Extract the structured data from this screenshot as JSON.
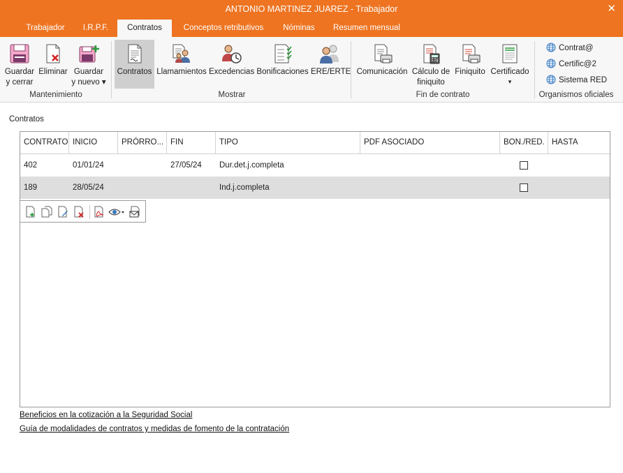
{
  "window": {
    "title": "ANTONIO MARTINEZ JUAREZ - Trabajador",
    "close_label": "✕"
  },
  "tabs": [
    {
      "label": "Trabajador"
    },
    {
      "label": "I.R.P.F."
    },
    {
      "label": "Contratos"
    },
    {
      "label": "Conceptos retributivos"
    },
    {
      "label": "Nóminas"
    },
    {
      "label": "Resumen mensual"
    }
  ],
  "ribbon": {
    "mantenimiento": {
      "label": "Mantenimiento",
      "guardar_cerrar": [
        "Guardar",
        "y cerrar"
      ],
      "eliminar": "Eliminar",
      "guardar_nuevo": [
        "Guardar",
        "y nuevo ▾"
      ]
    },
    "mostrar": {
      "label": "Mostrar",
      "contratos": "Contratos",
      "llamamientos": "Llamamientos",
      "excedencias": "Excedencias",
      "bonificaciones": "Bonificaciones",
      "ere": "ERE/ERTE"
    },
    "fin": {
      "label": "Fin de contrato",
      "comunicacion": "Comunicación",
      "calculo": [
        "Cálculo de",
        "finiquito"
      ],
      "finiquito": "Finiquito",
      "certificado": "Certificado",
      "certificado_arrow": "▾"
    },
    "organismos": {
      "label": "Organismos oficiales",
      "items": [
        "Contrat@",
        "Certific@2",
        "Sistema RED"
      ]
    }
  },
  "contratos": {
    "title": "Contratos",
    "columns": [
      "CONTRATO",
      "INICIO",
      "PRÓRRO...",
      "FIN",
      "TIPO",
      "PDF ASOCIADO",
      "BON./RED.",
      "HASTA"
    ],
    "rows": [
      {
        "contrato": "402",
        "inicio": "01/01/24",
        "prorroga": "",
        "fin": "27/05/24",
        "tipo": "Dur.det.j.completa",
        "pdf": "",
        "bonred": false,
        "hasta": ""
      },
      {
        "contrato": "189",
        "inicio": "28/05/24",
        "prorroga": "",
        "fin": "",
        "tipo": "Ind.j.completa",
        "pdf": "",
        "bonred": false,
        "hasta": ""
      }
    ]
  },
  "links": {
    "beneficios": "Beneficios en la cotización a la Seguridad Social",
    "guia": "Guía de modalidades de contratos y medidas de fomento de la contratación"
  },
  "colors": {
    "accent": "#ee7421",
    "ribbon_bg": "#f7f7f7",
    "selected": "#cfcfcf"
  }
}
